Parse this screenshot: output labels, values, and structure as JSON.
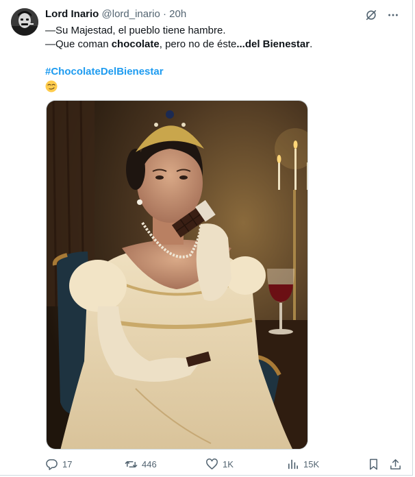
{
  "tweet": {
    "display_name": "Lord Inario",
    "handle": "@lord_inario",
    "separator": "·",
    "time": "20h",
    "line1": "—Su Majestad, el pueblo tiene hambre.",
    "line2_prefix": "—Que coman ",
    "line2_bold1": "chocolate",
    "line2_middle": ", pero no de éste",
    "line2_bold2": "...del Bienestar",
    "line2_suffix": ".",
    "hashtag": "#ChocolateDelBienestar",
    "emoji_icon": "smirking-face-emoji"
  },
  "actions": {
    "replies": "17",
    "reposts": "446",
    "likes": "1K",
    "views": "15K"
  },
  "colors": {
    "link": "#1d9bf0",
    "secondary_text": "#536471",
    "border": "#cfd9de"
  }
}
